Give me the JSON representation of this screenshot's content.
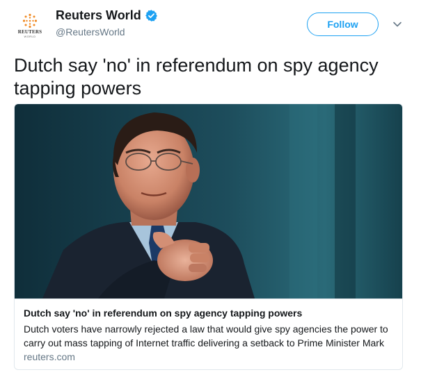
{
  "tweet": {
    "author": {
      "display_name": "Reuters World",
      "handle": "@ReutersWorld",
      "avatar_text": "REUTERS",
      "avatar_subtext": "WORLD",
      "verified_icon": "verified-badge-icon"
    },
    "follow_label": "Follow",
    "menu_icon": "chevron-down-icon",
    "text": "Dutch say 'no' in referendum on spy agency tapping powers"
  },
  "card": {
    "image_icon": "photo-man-pointing",
    "title": "Dutch say 'no' in referendum on spy agency tapping powers",
    "description": "Dutch voters have narrowly rejected a law that would give spy agencies the power to carry out mass tapping of Internet traffic delivering a setback to Prime Minister Mark",
    "domain": "reuters.com"
  },
  "colors": {
    "accent": "#1da1f2",
    "text": "#14171a",
    "secondary": "#657786",
    "border": "#e1e8ed",
    "reuters_orange": "#f08a24"
  }
}
